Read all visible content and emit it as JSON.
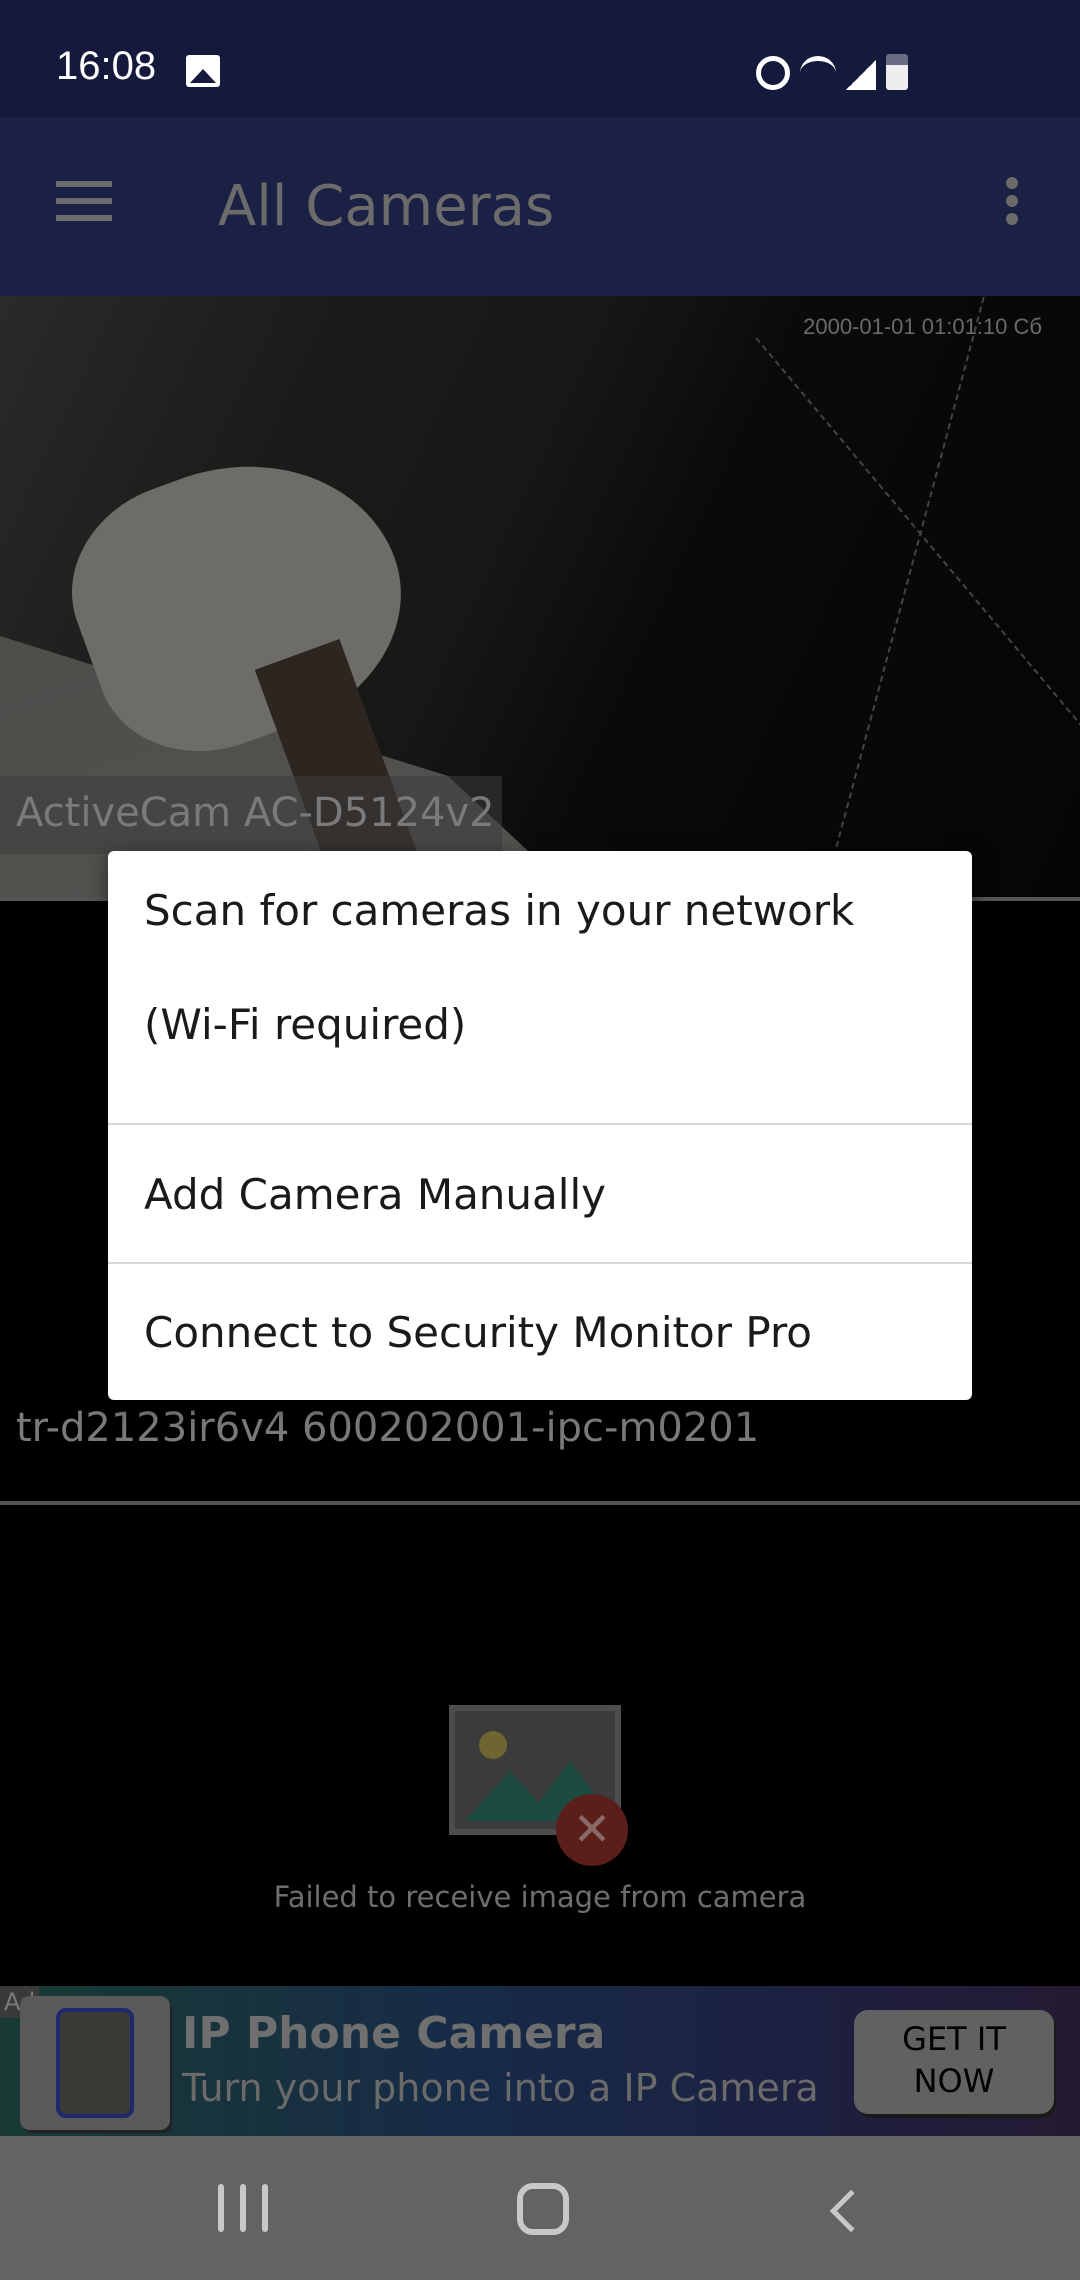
{
  "status_bar": {
    "time": "16:08",
    "icons": [
      "gallery-icon",
      "alarm-icon",
      "wifi-icon",
      "signal-icon",
      "battery-icon"
    ]
  },
  "app_bar": {
    "title": "All Cameras",
    "menu_icon": "hamburger-icon",
    "more_icon": "more-vert-icon"
  },
  "cameras": [
    {
      "name": "ActiveCam AC-D5124v2",
      "timestamp": "2000-01-01 01:01:10 Сб"
    },
    {
      "name": "tr-d2123ir6v4 600202001-ipc-m0201"
    },
    {
      "error": "Failed to receive image from camera"
    }
  ],
  "ad": {
    "tag": "Ad",
    "title": "IP Phone Camera",
    "subtitle": "Turn your phone into a IP Camera",
    "cta_line1": "GET IT",
    "cta_line2": "NOW"
  },
  "dialog": {
    "items": [
      {
        "line1": "Scan for cameras in your network",
        "line2": "(Wi-Fi required)"
      },
      {
        "label": "Add Camera Manually"
      },
      {
        "label": "Connect to Security Monitor Pro"
      }
    ]
  },
  "colors": {
    "status_bar": "#151a3c",
    "app_bar": "#1b2045",
    "nav_bar": "#636363",
    "dialog": "#ffffff"
  }
}
